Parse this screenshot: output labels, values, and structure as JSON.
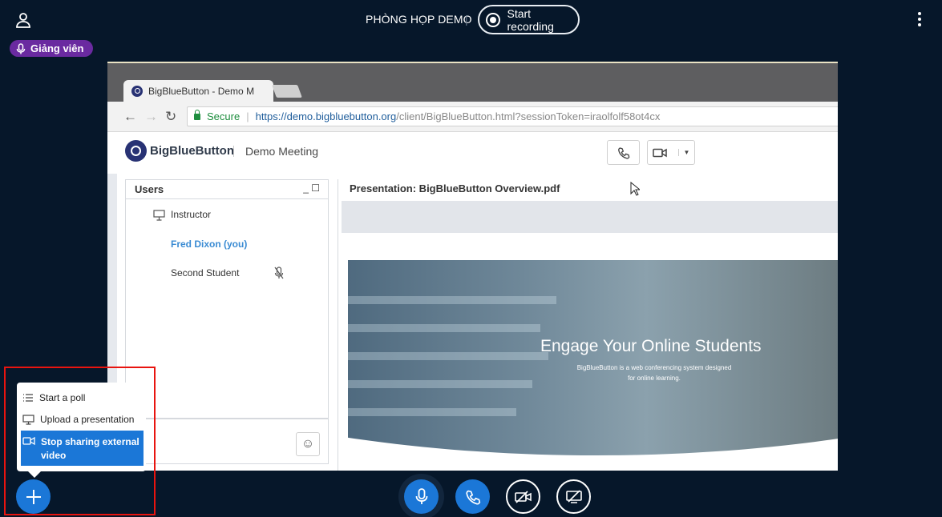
{
  "header": {
    "meeting_title": "PHÒNG HỌP DEMO",
    "separator": "|",
    "record_label": "Start recording"
  },
  "badge": {
    "role": "Giảng viên"
  },
  "screen": {
    "tab_title": "BigBlueButton - Demo M",
    "address": {
      "secure": "Secure",
      "url_host": "https://demo.bigbluebutton.org",
      "url_rest": "/client/BigBlueButton.html?sessionToken=iraolfolf58ot4cx"
    },
    "app": {
      "name": "BigBlueButton",
      "meeting": "Demo Meeting"
    },
    "users": {
      "title": "Users",
      "window_controls": "_ ☐",
      "list": [
        {
          "name": "Instructor",
          "role": "presenter"
        },
        {
          "name": "Fred Dixon (you)",
          "role": "self"
        },
        {
          "name": "Second Student",
          "role": "muted"
        }
      ]
    },
    "presentation": {
      "title": "Presentation: BigBlueButton Overview.pdf",
      "slide_heading": "Engage Your Online Students",
      "slide_sub": "BigBlueButton is a web conferencing system designed for online learning."
    }
  },
  "actions_menu": {
    "items": [
      {
        "label": "Start a poll",
        "icon": "poll-icon"
      },
      {
        "label": "Upload a presentation",
        "icon": "presentation-icon"
      },
      {
        "label": "Stop sharing external video",
        "icon": "video-icon"
      }
    ]
  },
  "colors": {
    "background": "#06172a",
    "accent": "#1b77d7",
    "badge": "#6a2aa0",
    "highlight": "#e8140f"
  }
}
